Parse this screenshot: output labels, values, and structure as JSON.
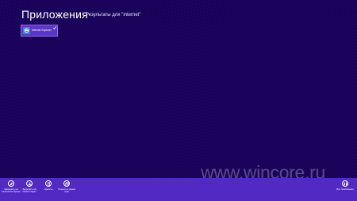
{
  "header": {
    "title": "Приложения",
    "subtitle": "Результаты для \"internet\""
  },
  "results": [
    {
      "label": "Internet Explorer",
      "icon": "internet-explorer-icon",
      "selected": true
    }
  ],
  "watermark": "www.wincore.ru",
  "app_bar": {
    "commands": [
      {
        "label": "Закрепить на начальном экране",
        "icon": "pin-icon"
      },
      {
        "label": "Закрепить на панели задач",
        "icon": "taskbar-pin-icon"
      },
      {
        "label": "Удалить",
        "icon": "uninstall-icon"
      },
      {
        "label": "Открыть в новом окне",
        "icon": "new-window-icon"
      }
    ],
    "right_command": {
      "label": "Все приложения",
      "icon": "all-apps-icon"
    }
  },
  "colors": {
    "background": "#180059",
    "tile": "#5a35c8",
    "app_bar": "#5329c4",
    "ie_blue": "#2f86d6"
  }
}
